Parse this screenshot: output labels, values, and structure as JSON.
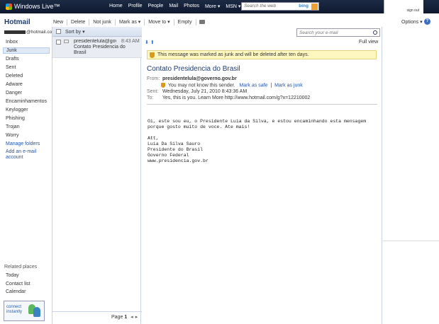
{
  "top_bar": {
    "brand": "Windows Live™",
    "nav": [
      "Home",
      "Profile",
      "People",
      "Mail",
      "Photos",
      "More ▾",
      "MSN ▾"
    ],
    "search_placeholder": "Search the web",
    "search_engine": "bing",
    "sign_out": "sign out"
  },
  "header": {
    "title": "Hotmail",
    "email_suffix": "@hotmail.com"
  },
  "toolbar": {
    "new": "New",
    "delete": "Delete",
    "not_junk": "Not junk",
    "mark_as": "Mark as ▾",
    "move_to": "Move to ▾",
    "empty": "Empty",
    "options": "Options ▾",
    "help": "?"
  },
  "folders": [
    {
      "label": "Inbox"
    },
    {
      "label": "Junk",
      "active": true
    },
    {
      "label": "Drafts"
    },
    {
      "label": "Sent"
    },
    {
      "label": "Deleted"
    },
    {
      "label": "Adware"
    },
    {
      "label": "Danger"
    },
    {
      "label": "Encaminhamentos"
    },
    {
      "label": "Keylogger"
    },
    {
      "label": "Phishing"
    },
    {
      "label": "Trojan"
    },
    {
      "label": "Worry"
    }
  ],
  "sidebar_links": {
    "manage_folders": "Manage folders",
    "add_account_1": "Add an e-mail",
    "add_account_2": "account"
  },
  "related": {
    "title": "Related places",
    "items": [
      "Today",
      "Contact list",
      "Calendar"
    ]
  },
  "connect": {
    "line1": "connect",
    "line2": "instantly"
  },
  "message_list": {
    "sort_by": "Sort by ▾",
    "messages": [
      {
        "sender": "presidentelula@gov...",
        "time": "8:43 AM",
        "subject": "Contato Presidencia do Brasil"
      }
    ],
    "page_label": "Page",
    "page_number": "1"
  },
  "search_email": {
    "placeholder": "Search your e-mail"
  },
  "reading_pane": {
    "full_view": "Full view",
    "junk_notice": "This message was marked as junk and will be deleted after ten days.",
    "subject": "Contato Presidencia do Brasil",
    "from_label": "From:",
    "from": "presidentelula@governo.gov.br",
    "unknown_sender": "You may not know this sender.",
    "mark_safe": "Mark as safe",
    "separator": "|",
    "mark_junk": "Mark as junk",
    "sent_label": "Sent:",
    "sent": "Wednesday, July 21, 2010 8:43:36 AM",
    "to_label": "To:",
    "to": "Yes, this is you. Learn More http://www.hotmail.com/g?x=12210002",
    "body_lines": [
      "Oi, este sou eu, o Presidente Luia da Silva, e estou encaminhando esta mensagem",
      "porque gosto muito de voce. Ate mais!",
      "",
      "Att,",
      "Luia Da Silva Sauro",
      "Presidente do Brasil",
      "Governo Federal",
      "www.presidencia.gov.br"
    ]
  },
  "colors": {
    "topbar": "#1c2a44",
    "accent": "#1e3c6e",
    "link": "#2255aa",
    "junk_bar": "#fff7c0"
  }
}
